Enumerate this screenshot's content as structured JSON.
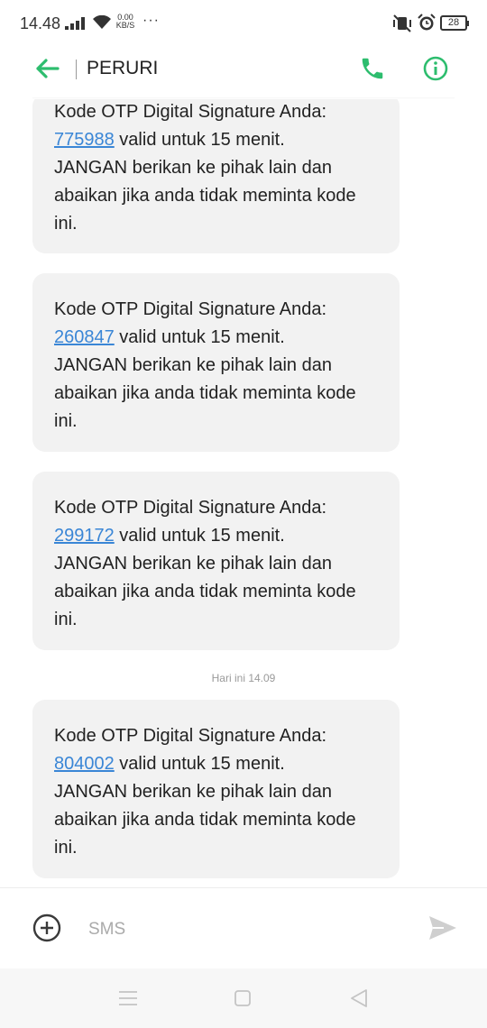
{
  "status_bar": {
    "time": "14.48",
    "net_speed_value": "0.00",
    "net_speed_unit": "KB/S",
    "more": "···",
    "battery": "28",
    "icons": [
      "signal-icon",
      "wifi-icon",
      "vibrate-off-icon",
      "alarm-icon",
      "battery-icon"
    ]
  },
  "header": {
    "title": "PERURI",
    "icons": [
      "back-arrow-icon",
      "phone-icon",
      "info-icon"
    ],
    "accent_color": "#2dbd6e"
  },
  "messages": [
    {
      "line1": "Kode OTP Digital Signature Anda:",
      "otp": "775988",
      "after_otp": " valid untuk 15 menit.",
      "line3": "JANGAN berikan ke pihak lain dan",
      "line4": "abaikan jika anda tidak meminta kode",
      "line5": "ini."
    },
    {
      "line1": "Kode OTP Digital Signature Anda:",
      "otp": "260847",
      "after_otp": " valid untuk 15 menit.",
      "line3": "JANGAN berikan ke pihak lain dan",
      "line4": "abaikan jika anda tidak meminta kode",
      "line5": "ini."
    },
    {
      "line1": "Kode OTP Digital Signature Anda:",
      "otp": "299172",
      "after_otp": " valid untuk 15 menit.",
      "line3": "JANGAN berikan ke pihak lain dan",
      "line4": "abaikan jika anda tidak meminta kode",
      "line5": "ini."
    },
    {
      "line1": "Kode OTP Digital Signature Anda:",
      "otp": "804002",
      "after_otp": " valid untuk 15 menit.",
      "line3": "JANGAN berikan ke pihak lain dan",
      "line4": "abaikan jika anda tidak meminta kode",
      "line5": "ini."
    }
  ],
  "date_separator": "Hari ini 14.09",
  "compose": {
    "placeholder": "SMS",
    "icons": [
      "add-circle-icon",
      "send-icon"
    ]
  },
  "nav_bar": {
    "icons": [
      "menu-icon",
      "home-icon",
      "back-triangle-icon"
    ]
  },
  "colors": {
    "bubble_bg": "#f2f2f2",
    "link": "#3a86d6"
  }
}
